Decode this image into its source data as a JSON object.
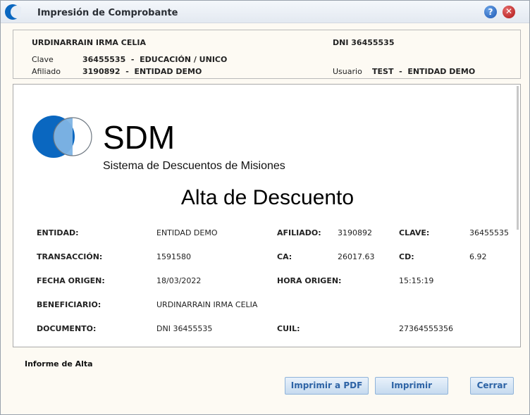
{
  "window": {
    "title": "Impresión de Comprobante",
    "help_symbol": "?",
    "close_symbol": "✕"
  },
  "header": {
    "name": "URDINARRAIN IRMA CELIA",
    "dni": "DNI 36455535",
    "clave_label": "Clave",
    "clave_value": "36455535  -  EDUCACIÓN / UNICO",
    "afiliado_label": "Afiliado",
    "afiliado_value": "3190892  -  ENTIDAD DEMO",
    "usuario_label": "Usuario",
    "usuario_value": "TEST  -  ENTIDAD DEMO"
  },
  "document": {
    "brand": "SDM",
    "brand_subtitle": "Sistema de Descuentos de Misiones",
    "title": "Alta de Descuento",
    "fields": {
      "entidad_label": "ENTIDAD:",
      "entidad_value": "ENTIDAD DEMO",
      "afiliado_label": "AFILIADO:",
      "afiliado_value": "3190892",
      "clave_label": "CLAVE:",
      "clave_value": "36455535",
      "transaccion_label": "TRANSACCIÓN:",
      "transaccion_value": "1591580",
      "ca_label": "CA:",
      "ca_value": "26017.63",
      "cd_label": "CD:",
      "cd_value": "6.92",
      "fecha_label": "FECHA ORIGEN:",
      "fecha_value": "18/03/2022",
      "hora_label": "HORA ORIGEN:",
      "hora_value": "15:15:19",
      "beneficiario_label": "BENEFICIARIO:",
      "beneficiario_value": "URDINARRAIN IRMA CELIA",
      "documento_label": "DOCUMENTO:",
      "documento_value": "DNI 36455535",
      "cuil_label": "CUIL:",
      "cuil_value": "27364555356"
    }
  },
  "footer": {
    "report_title": "Informe de Alta",
    "pdf_button": "Imprimir a PDF",
    "print_button": "Imprimir",
    "close_button": "Cerrar"
  },
  "colors": {
    "brand_blue": "#0a67c0",
    "button_text": "#2d63a5"
  }
}
